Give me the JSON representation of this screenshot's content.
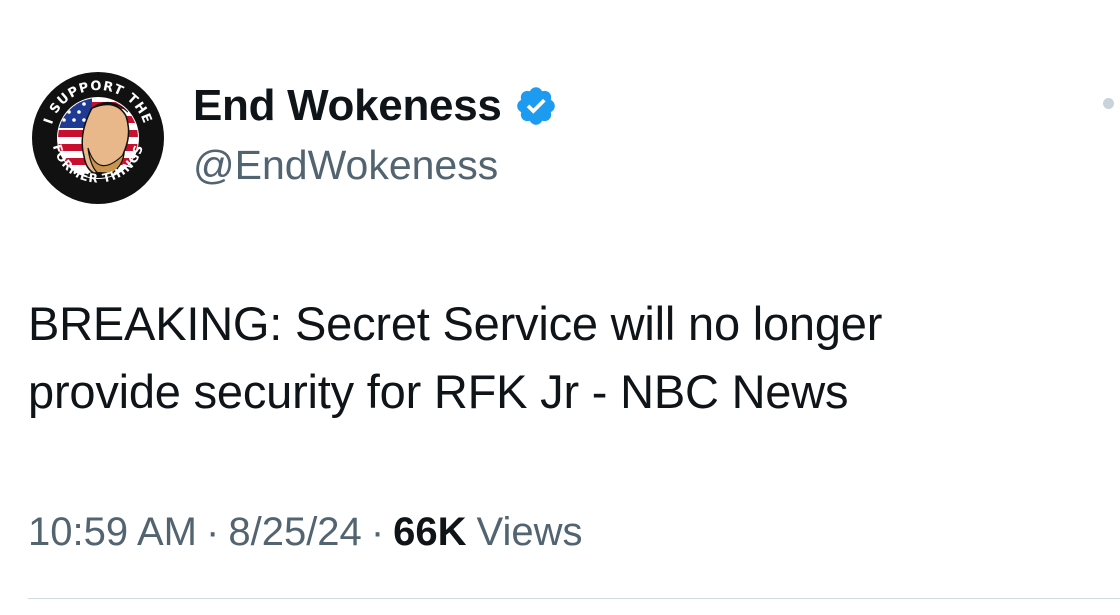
{
  "author": {
    "display_name": "End Wokeness",
    "handle": "@EndWokeness",
    "verified": true,
    "avatar_text_top": "I SUPPORT THE",
    "avatar_text_bottom": "FORMER THINGS"
  },
  "tweet": {
    "text_line1": "BREAKING: Secret Service will no longer",
    "text_line2": "provide security for RFK Jr - NBC News",
    "time": "10:59 AM",
    "separator": "·",
    "date": "8/25/24",
    "views_count": "66K",
    "views_label": "Views"
  },
  "colors": {
    "primary_text": "#0f1419",
    "secondary_text": "#536471",
    "verified_blue": "#1d9bf0",
    "divider": "#cfd9de"
  },
  "icons": {
    "verified": "verified-badge-icon",
    "more": "more-options-icon"
  }
}
